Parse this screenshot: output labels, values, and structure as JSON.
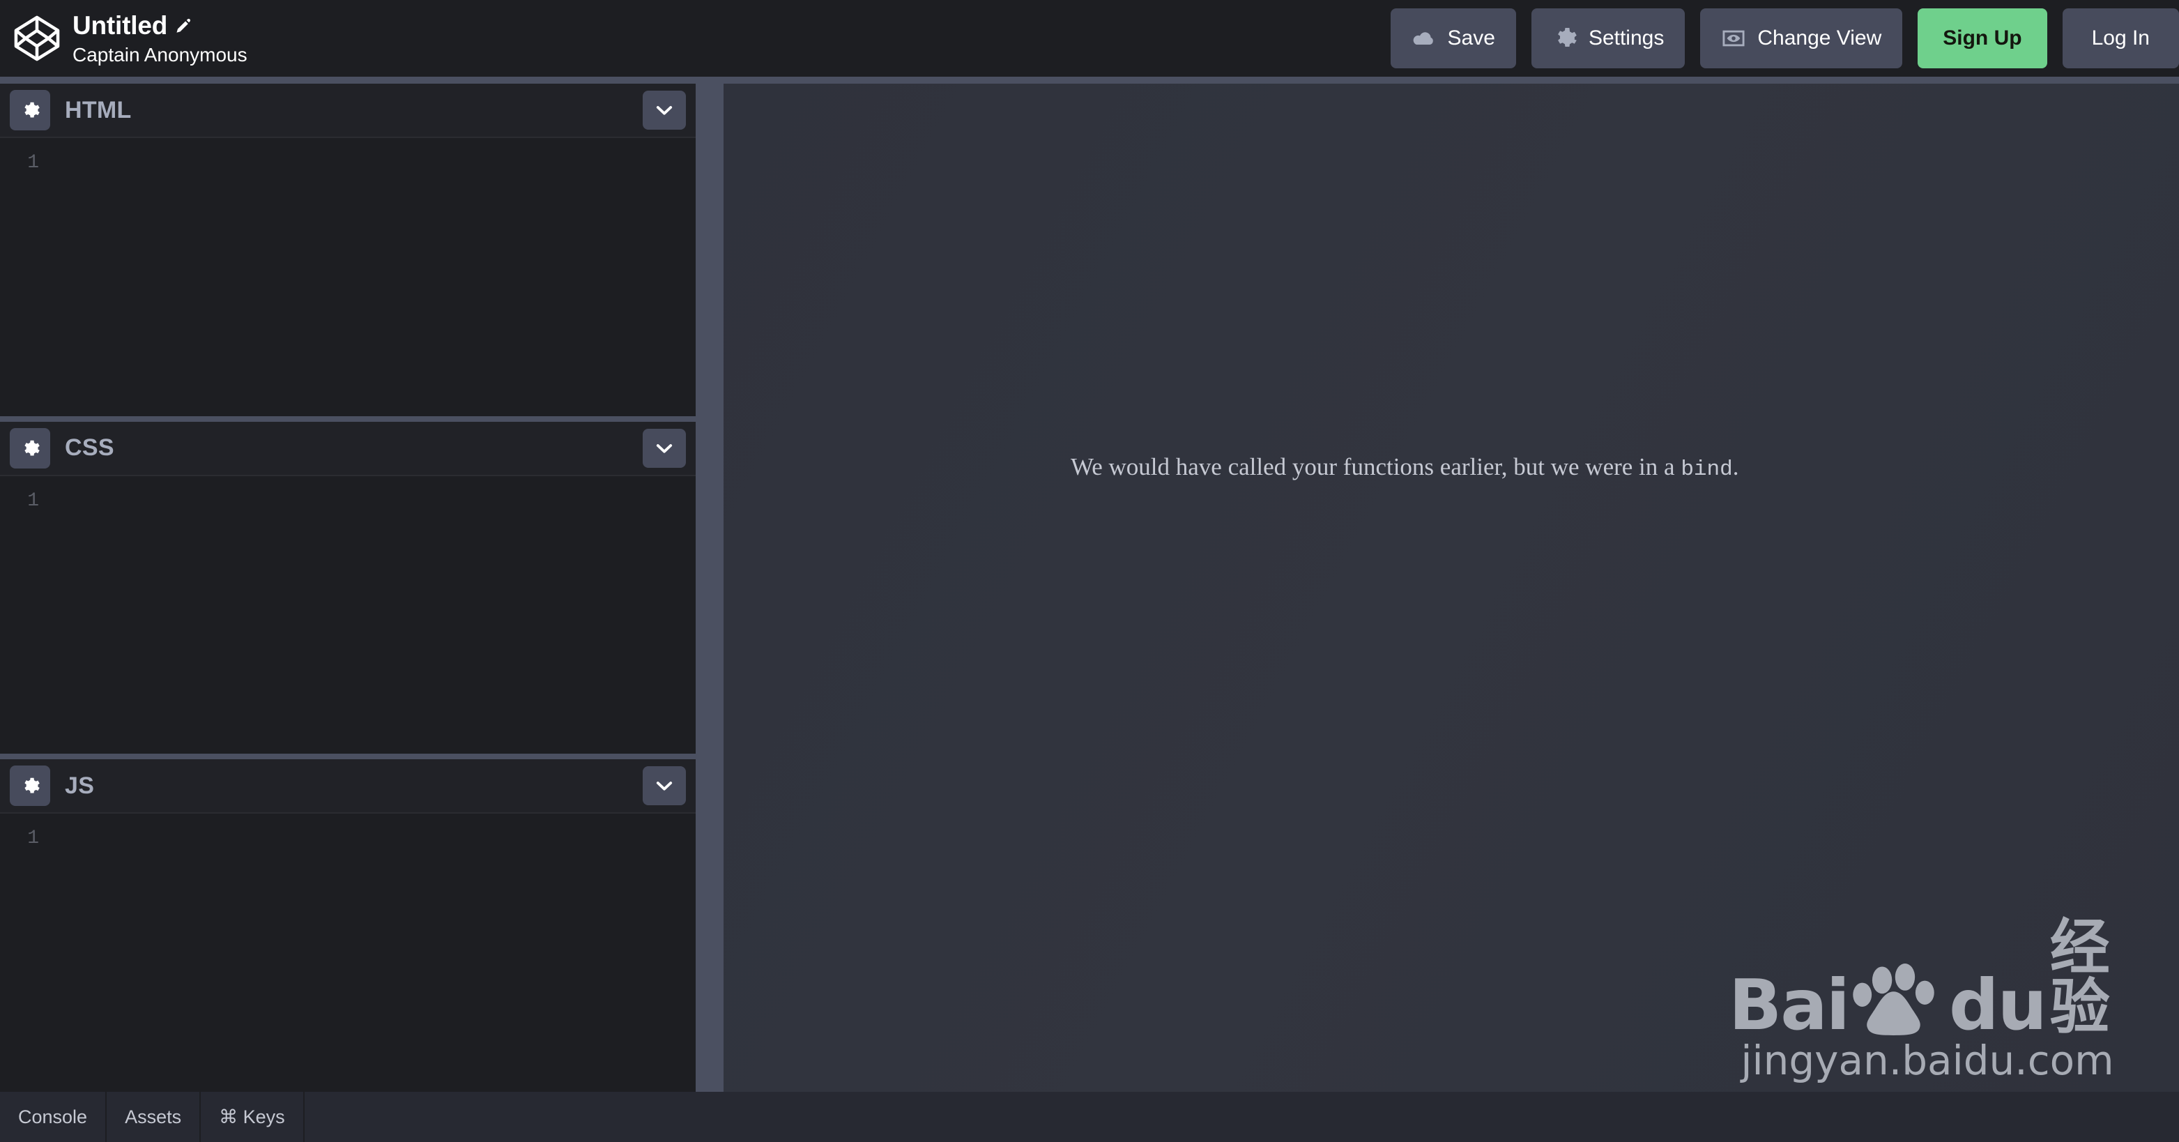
{
  "app": {
    "logo_name": "codepen-logo",
    "background": "#1d1e22",
    "accent_green": "#6fd08c",
    "panel_button": "#474b5c",
    "preview_background": "#30333d"
  },
  "header": {
    "pen_title": "Untitled",
    "edit_title_icon": "pencil-icon",
    "author": "Captain Anonymous",
    "buttons": [
      {
        "label": "Save",
        "icon": "cloud-icon",
        "style": "default"
      },
      {
        "label": "Settings",
        "icon": "gear-icon",
        "style": "default"
      },
      {
        "label": "Change View",
        "icon": "eye-in-frame-icon",
        "style": "default"
      },
      {
        "label": "Sign Up",
        "icon": "",
        "style": "primary"
      },
      {
        "label": "Log In",
        "icon": "",
        "style": "default"
      }
    ]
  },
  "editors": [
    {
      "label": "HTML",
      "settings_icon": "gear-icon",
      "collapse_icon": "chevron-down-icon",
      "line_number": "1",
      "code": ""
    },
    {
      "label": "CSS",
      "settings_icon": "gear-icon",
      "collapse_icon": "chevron-down-icon",
      "line_number": "1",
      "code": ""
    },
    {
      "label": "JS",
      "settings_icon": "gear-icon",
      "collapse_icon": "chevron-down-icon",
      "line_number": "1",
      "code": ""
    }
  ],
  "preview": {
    "message_before": "We would have called your functions earlier, but we were in a ",
    "message_code": "bind",
    "message_after": "."
  },
  "watermark": {
    "brand_left": "Bai",
    "paw_icon": "baidu-paw-icon",
    "brand_right": "du",
    "brand_cn": "经验",
    "url": "jingyan.baidu.com"
  },
  "bottom_bar": {
    "tabs": [
      {
        "label": "Console",
        "icon": ""
      },
      {
        "label": "Assets",
        "icon": ""
      },
      {
        "label": "⌘ Keys",
        "icon": "command-icon"
      }
    ]
  }
}
